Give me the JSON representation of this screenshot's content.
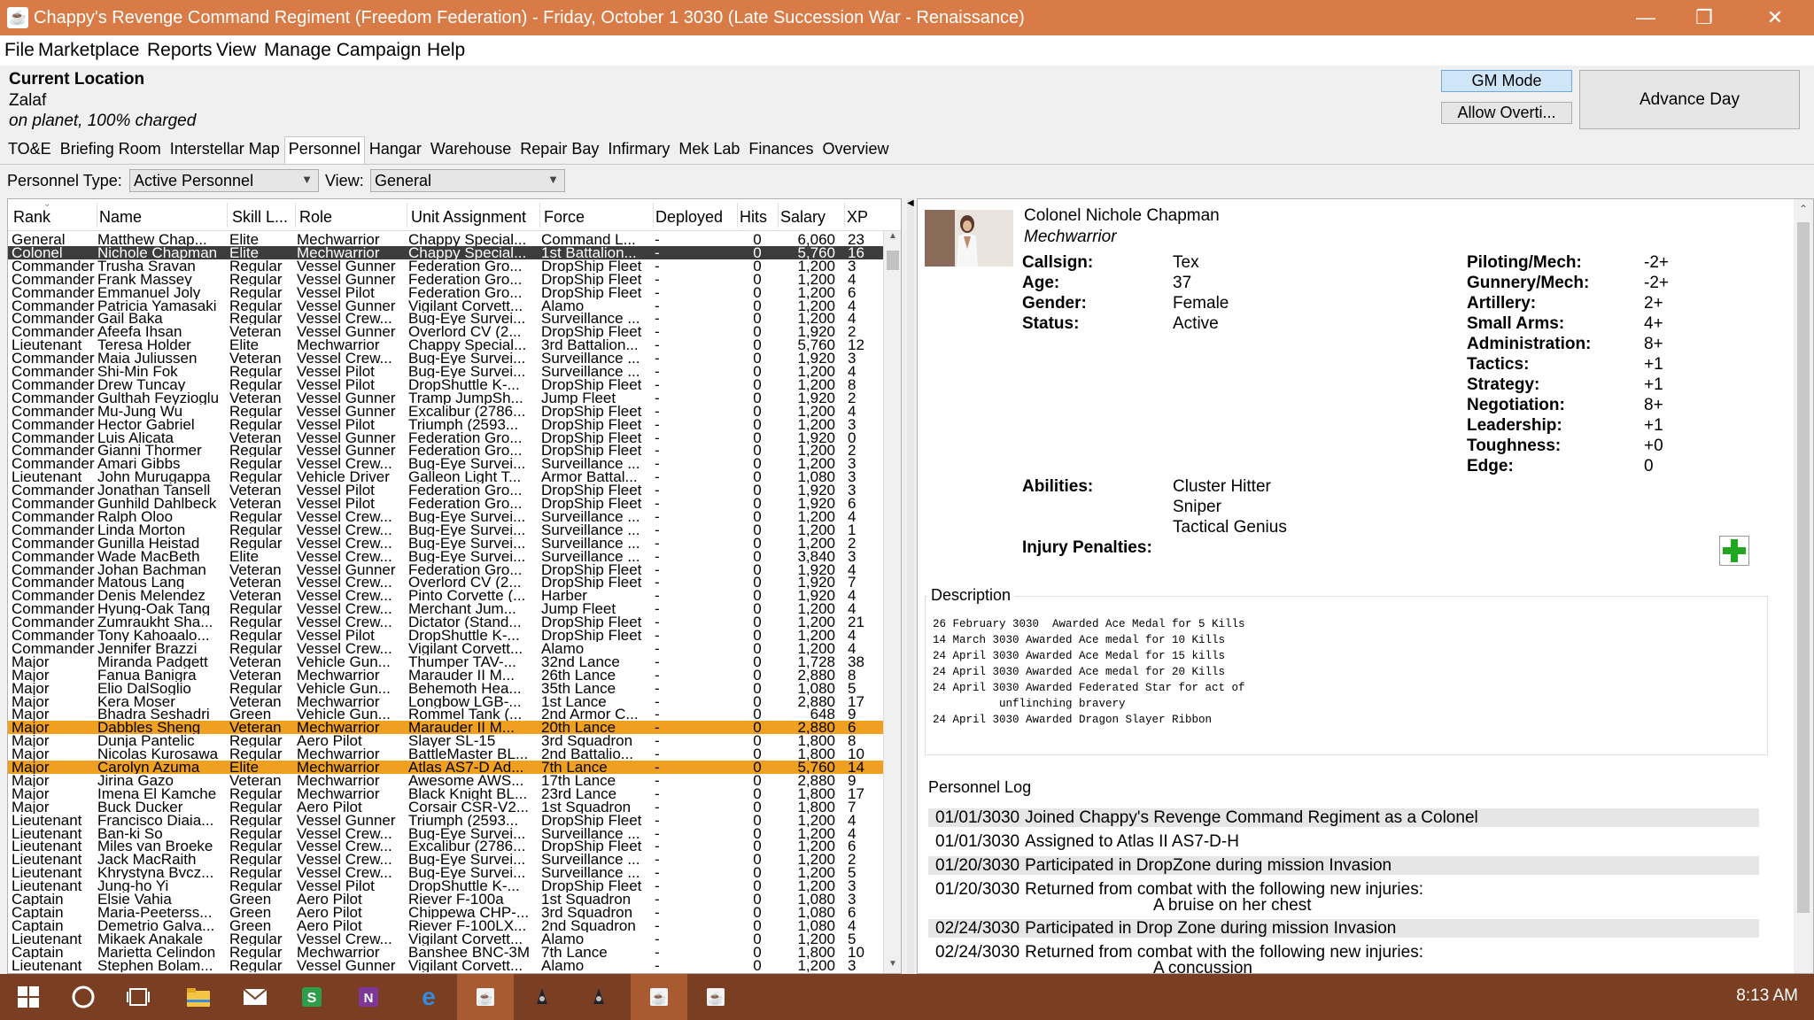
{
  "window": {
    "title": "Chappy's Revenge Command Regiment (Freedom Federation) - Friday, October 1 3030 (Late Succession War - Renaissance)",
    "controls": [
      "—",
      "❐",
      "✕"
    ]
  },
  "menu": [
    "File",
    "Marketplace",
    "Reports",
    "View",
    "Manage Campaign",
    "Help"
  ],
  "location": {
    "heading": "Current Location",
    "planet": "Zalaf",
    "status": "on planet, 100% charged"
  },
  "buttons": {
    "gm_mode": "GM Mode",
    "allow_overtime": "Allow Overti...",
    "advance_day": "Advance Day"
  },
  "tabs": [
    "TO&E",
    "Briefing Room",
    "Interstellar Map",
    "Personnel",
    "Hangar",
    "Warehouse",
    "Repair Bay",
    "Infirmary",
    "Mek Lab",
    "Finances",
    "Overview"
  ],
  "active_tab": "Personnel",
  "filters": {
    "personnel_type_label": "Personnel Type:",
    "personnel_type_value": "Active Personnel",
    "view_label": "View:",
    "view_value": "General"
  },
  "table": {
    "columns": [
      "Rank",
      "Name",
      "Skill L...",
      "Role",
      "Unit Assignment",
      "Force",
      "Deployed",
      "Hits",
      "Salary",
      "XP"
    ],
    "rows": [
      [
        "General",
        "Matthew Chap...",
        "Elite",
        "Mechwarrior",
        "Chappy Special...",
        "Command L...",
        "-",
        "0",
        "6,060",
        "23",
        ""
      ],
      [
        "Colonel",
        "Nichole Chapman",
        "Elite",
        "Mechwarrior",
        "Chappy Special...",
        "1st Battalion...",
        "-",
        "0",
        "5,760",
        "16",
        "sel"
      ],
      [
        "Commander",
        "Trusha Sravan",
        "Regular",
        "Vessel Gunner",
        "Federation Gro...",
        "DropShip Fleet",
        "-",
        "0",
        "1,200",
        "3",
        ""
      ],
      [
        "Commander",
        "Frank Massey",
        "Regular",
        "Vessel Gunner",
        "Federation Gro...",
        "DropShip Fleet",
        "-",
        "0",
        "1,200",
        "4",
        ""
      ],
      [
        "Commander",
        "Emmanuel Joly",
        "Regular",
        "Vessel Pilot",
        "Federation Gro...",
        "DropShip Fleet",
        "-",
        "0",
        "1,200",
        "6",
        ""
      ],
      [
        "Commander",
        "Patricia Yamasaki",
        "Regular",
        "Vessel Gunner",
        "Vigilant Corvett...",
        "Alamo",
        "-",
        "0",
        "1,200",
        "4",
        ""
      ],
      [
        "Commander",
        "Gail Baka",
        "Regular",
        "Vessel Crew...",
        "Bug-Eye Survei...",
        "Surveillance ...",
        "-",
        "0",
        "1,200",
        "4",
        ""
      ],
      [
        "Commander",
        "Afeefa Ihsan",
        "Veteran",
        "Vessel Gunner",
        "Overlord CV (2...",
        "DropShip Fleet",
        "-",
        "0",
        "1,920",
        "2",
        ""
      ],
      [
        "Lieutenant",
        "Teresa Holder",
        "Elite",
        "Mechwarrior",
        "Chappy Special...",
        "3rd Battalion...",
        "-",
        "0",
        "5,760",
        "12",
        ""
      ],
      [
        "Commander",
        "Maia Juliussen",
        "Veteran",
        "Vessel Crew...",
        "Bug-Eye Survei...",
        "Surveillance ...",
        "-",
        "0",
        "1,920",
        "3",
        ""
      ],
      [
        "Commander",
        "Shi-Min Fok",
        "Regular",
        "Vessel Pilot",
        "Bug-Eye Survei...",
        "Surveillance ...",
        "-",
        "0",
        "1,200",
        "4",
        ""
      ],
      [
        "Commander",
        "Drew Tuncay",
        "Regular",
        "Vessel Pilot",
        "DropShuttle K-...",
        "DropShip Fleet",
        "-",
        "0",
        "1,200",
        "8",
        ""
      ],
      [
        "Commander",
        "Gulthah Feyzioglu",
        "Veteran",
        "Vessel Gunner",
        "Tramp JumpSh...",
        "Jump Fleet",
        "-",
        "0",
        "1,920",
        "2",
        ""
      ],
      [
        "Commander",
        "Mu-Jung Wu",
        "Regular",
        "Vessel Gunner",
        "Excalibur (2786...",
        "DropShip Fleet",
        "-",
        "0",
        "1,200",
        "4",
        ""
      ],
      [
        "Commander",
        "Hector Gabriel",
        "Regular",
        "Vessel Pilot",
        "Triumph (2593...",
        "DropShip Fleet",
        "-",
        "0",
        "1,200",
        "3",
        ""
      ],
      [
        "Commander",
        "Luis Alicata",
        "Veteran",
        "Vessel Gunner",
        "Federation Gro...",
        "DropShip Fleet",
        "-",
        "0",
        "1,920",
        "0",
        ""
      ],
      [
        "Commander",
        "Gianni Thormer",
        "Regular",
        "Vessel Gunner",
        "Federation Gro...",
        "DropShip Fleet",
        "-",
        "0",
        "1,200",
        "2",
        ""
      ],
      [
        "Commander",
        "Amari Gibbs",
        "Regular",
        "Vessel Crew...",
        "Bug-Eye Survei...",
        "Surveillance ...",
        "-",
        "0",
        "1,200",
        "3",
        ""
      ],
      [
        "Lieutenant",
        "John Murugappa",
        "Regular",
        "Vehicle Driver",
        "Galleon Light T...",
        "Armor Battal...",
        "-",
        "0",
        "1,080",
        "3",
        ""
      ],
      [
        "Commander",
        "Jonathan Tansell",
        "Veteran",
        "Vessel Pilot",
        "Federation Gro...",
        "DropShip Fleet",
        "-",
        "0",
        "1,920",
        "3",
        ""
      ],
      [
        "Commander",
        "Gunhild Dahlbeck",
        "Veteran",
        "Vessel Pilot",
        "Federation Gro...",
        "DropShip Fleet",
        "-",
        "0",
        "1,920",
        "6",
        ""
      ],
      [
        "Commander",
        "Ralph Oloo",
        "Regular",
        "Vessel Crew...",
        "Bug-Eye Survei...",
        "Surveillance ...",
        "-",
        "0",
        "1,200",
        "4",
        ""
      ],
      [
        "Commander",
        "Linda Morton",
        "Regular",
        "Vessel Crew...",
        "Bug-Eye Survei...",
        "Surveillance ...",
        "-",
        "0",
        "1,200",
        "1",
        ""
      ],
      [
        "Commander",
        "Gunilla Heistad",
        "Regular",
        "Vessel Crew...",
        "Bug-Eye Survei...",
        "Surveillance ...",
        "-",
        "0",
        "1,200",
        "2",
        ""
      ],
      [
        "Commander",
        "Wade MacBeth",
        "Elite",
        "Vessel Crew...",
        "Bug-Eye Survei...",
        "Surveillance ...",
        "-",
        "0",
        "3,840",
        "3",
        ""
      ],
      [
        "Commander",
        "Johan Bachman",
        "Veteran",
        "Vessel Gunner",
        "Federation Gro...",
        "DropShip Fleet",
        "-",
        "0",
        "1,920",
        "4",
        ""
      ],
      [
        "Commander",
        "Matous Lang",
        "Veteran",
        "Vessel Crew...",
        "Overlord CV (2...",
        "DropShip Fleet",
        "-",
        "0",
        "1,920",
        "7",
        ""
      ],
      [
        "Commander",
        "Denis Melendez",
        "Veteran",
        "Vessel Crew...",
        "Pinto Corvette (...",
        "Harber",
        "-",
        "0",
        "1,920",
        "4",
        ""
      ],
      [
        "Commander",
        "Hyung-Oak Tang",
        "Regular",
        "Vessel Crew...",
        "Merchant Jum...",
        "Jump Fleet",
        "-",
        "0",
        "1,200",
        "4",
        ""
      ],
      [
        "Commander",
        "Zumraukht Sha...",
        "Regular",
        "Vessel Crew...",
        "Dictator (Stand...",
        "DropShip Fleet",
        "-",
        "0",
        "1,200",
        "21",
        ""
      ],
      [
        "Commander",
        "Tony Kahoaalo...",
        "Regular",
        "Vessel Pilot",
        "DropShuttle K-...",
        "DropShip Fleet",
        "-",
        "0",
        "1,200",
        "4",
        ""
      ],
      [
        "Commander",
        "Jennifer Brazzi",
        "Regular",
        "Vessel Crew...",
        "Vigilant Corvett...",
        "Alamo",
        "-",
        "0",
        "1,200",
        "4",
        ""
      ],
      [
        "Major",
        "Miranda Padgett",
        "Veteran",
        "Vehicle Gun...",
        "Thumper TAV-...",
        "32nd Lance",
        "-",
        "0",
        "1,728",
        "38",
        ""
      ],
      [
        "Major",
        "Fanua Banigra",
        "Veteran",
        "Mechwarrior",
        "Marauder II M...",
        "26th Lance",
        "-",
        "0",
        "2,880",
        "8",
        ""
      ],
      [
        "Major",
        "Elio DalSoglio",
        "Regular",
        "Vehicle Gun...",
        "Behemoth Hea...",
        "35th Lance",
        "-",
        "0",
        "1,080",
        "5",
        ""
      ],
      [
        "Major",
        "Kera Moser",
        "Veteran",
        "Mechwarrior",
        "Longbow LGB-...",
        "1st Lance",
        "-",
        "0",
        "2,880",
        "17",
        ""
      ],
      [
        "Major",
        "Bhadra Seshadri",
        "Green",
        "Vehicle Gun...",
        "Rommel Tank (...",
        "2nd Armor C...",
        "-",
        "0",
        "648",
        "9",
        ""
      ],
      [
        "Major",
        "Dabbles Sheng",
        "Veteran",
        "Mechwarrior",
        "Marauder II M...",
        "20th Lance",
        "-",
        "0",
        "2,880",
        "6",
        "hl"
      ],
      [
        "Major",
        "Dunja Pantelic",
        "Regular",
        "Aero Pilot",
        "Slayer SL-15",
        "3rd Squadron",
        "-",
        "0",
        "1,800",
        "8",
        ""
      ],
      [
        "Major",
        "Nicolas Kurosawa",
        "Regular",
        "Mechwarrior",
        "BattleMaster BL...",
        "2nd Battalio...",
        "-",
        "0",
        "1,800",
        "10",
        ""
      ],
      [
        "Major",
        "Carolyn Azuma",
        "Elite",
        "Mechwarrior",
        "Atlas AS7-D Ad...",
        "7th Lance",
        "-",
        "0",
        "5,760",
        "14",
        "hl"
      ],
      [
        "Major",
        "Jirina Gazo",
        "Veteran",
        "Mechwarrior",
        "Awesome AWS...",
        "17th Lance",
        "-",
        "0",
        "2,880",
        "9",
        ""
      ],
      [
        "Major",
        "Imena El Kamche",
        "Regular",
        "Mechwarrior",
        "Black Knight BL...",
        "23rd Lance",
        "-",
        "0",
        "1,800",
        "17",
        ""
      ],
      [
        "Major",
        "Buck Ducker",
        "Regular",
        "Aero Pilot",
        "Corsair CSR-V2...",
        "1st Squadron",
        "-",
        "0",
        "1,800",
        "7",
        ""
      ],
      [
        "Lieutenant",
        "Francisco Diaia...",
        "Regular",
        "Vessel Gunner",
        "Triumph (2593...",
        "DropShip Fleet",
        "-",
        "0",
        "1,200",
        "4",
        ""
      ],
      [
        "Lieutenant",
        "Ban-ki So",
        "Regular",
        "Vessel Crew...",
        "Bug-Eye Survei...",
        "Surveillance ...",
        "-",
        "0",
        "1,200",
        "4",
        ""
      ],
      [
        "Lieutenant",
        "Miles van Broeke",
        "Regular",
        "Vessel Crew...",
        "Excalibur (2786...",
        "DropShip Fleet",
        "-",
        "0",
        "1,200",
        "6",
        ""
      ],
      [
        "Lieutenant",
        "Jack MacRaith",
        "Regular",
        "Vessel Crew...",
        "Bug-Eye Survei...",
        "Surveillance ...",
        "-",
        "0",
        "1,200",
        "2",
        ""
      ],
      [
        "Lieutenant",
        "Khrystyna Bvcz...",
        "Regular",
        "Vessel Crew...",
        "Bug-Eye Survei...",
        "Surveillance ...",
        "-",
        "0",
        "1,200",
        "5",
        ""
      ],
      [
        "Lieutenant",
        "Jung-ho Yi",
        "Regular",
        "Vessel Pilot",
        "DropShuttle K-...",
        "DropShip Fleet",
        "-",
        "0",
        "1,200",
        "3",
        ""
      ],
      [
        "Captain",
        "Elsie Vahia",
        "Green",
        "Aero Pilot",
        "Riever F-100a",
        "1st Squadron",
        "-",
        "0",
        "1,080",
        "3",
        ""
      ],
      [
        "Captain",
        "Maria-Peeterss...",
        "Green",
        "Aero Pilot",
        "Chippewa CHP-...",
        "3rd Squadron",
        "-",
        "0",
        "1,080",
        "6",
        ""
      ],
      [
        "Captain",
        "Demetrio Galva...",
        "Green",
        "Aero Pilot",
        "Riever F-100LX...",
        "2nd Squadron",
        "-",
        "0",
        "1,080",
        "4",
        ""
      ],
      [
        "Lieutenant",
        "Mikaek Anakale",
        "Regular",
        "Vessel Crew...",
        "Vigilant Corvett...",
        "Alamo",
        "-",
        "0",
        "1,200",
        "5",
        ""
      ],
      [
        "Captain",
        "Marietta Celindon",
        "Regular",
        "Mechwarrior",
        "Banshee BNC-3M",
        "7th Lance",
        "-",
        "0",
        "1,800",
        "10",
        ""
      ],
      [
        "Lieutenant",
        "Stephen Bolam...",
        "Regular",
        "Vessel Gunner",
        "Vigilant Corvett...",
        "Alamo",
        "-",
        "0",
        "1,200",
        "3",
        ""
      ]
    ]
  },
  "detail": {
    "full_name": "Colonel Nichole Chapman",
    "role": "Mechwarrior",
    "fields": [
      {
        "label": "Callsign:",
        "value": "Tex"
      },
      {
        "label": "Age:",
        "value": "37"
      },
      {
        "label": "Gender:",
        "value": "Female"
      },
      {
        "label": "Status:",
        "value": "Active"
      }
    ],
    "skills": [
      {
        "label": "Piloting/Mech:",
        "value": "-2+"
      },
      {
        "label": "Gunnery/Mech:",
        "value": "-2+"
      },
      {
        "label": "Artillery:",
        "value": "2+"
      },
      {
        "label": "Small Arms:",
        "value": "4+"
      },
      {
        "label": "Administration:",
        "value": "8+"
      },
      {
        "label": "Tactics:",
        "value": "+1"
      },
      {
        "label": "Strategy:",
        "value": "+1"
      },
      {
        "label": "Negotiation:",
        "value": "8+"
      },
      {
        "label": "Leadership:",
        "value": "+1"
      },
      {
        "label": "Toughness:",
        "value": "+0"
      },
      {
        "label": "Edge:",
        "value": "0"
      }
    ],
    "abilities_label": "Abilities:",
    "abilities": [
      "Cluster Hitter",
      "Sniper",
      "Tactical Genius"
    ],
    "injury_label": "Injury Penalties:",
    "description_title": "Description",
    "description_lines": [
      "26 February 3030  Awarded Ace Medal for 5 Kills",
      "14 March 3030 Awarded Ace medal for 10 Kills",
      "24 April 3030 Awarded Ace Medal for 15 kills",
      "24 April 3030 Awarded Ace medal for 20 Kills",
      "24 April 3030 Awarded Federated Star for act of",
      "          unflinching bravery",
      "24 April 3030 Awarded Dragon Slayer Ribbon"
    ],
    "log_title": "Personnel Log",
    "log": [
      {
        "date": "01/01/3030",
        "text": "Joined Chappy's Revenge Command Regiment as a Colonel",
        "shade": true
      },
      {
        "date": "01/01/3030",
        "text": "Assigned to Atlas II AS7-D-H",
        "shade": false
      },
      {
        "date": "01/20/3030",
        "text": "Participated in DropZone during mission Invasion",
        "shade": true
      },
      {
        "date": "01/20/3030",
        "text": "Returned from combat with the following new injuries:",
        "sub": "A bruise on her chest",
        "shade": false
      },
      {
        "date": "02/24/3030",
        "text": "Participated in Drop Zone  during mission Invasion",
        "shade": true
      },
      {
        "date": "02/24/3030",
        "text": "Returned from combat with the following new injuries:",
        "sub": "A concussion",
        "shade": false
      }
    ]
  },
  "taskbar": {
    "clock": "8:13 AM",
    "icons": [
      "windows-start-icon",
      "cortana-icon",
      "task-view-icon",
      "file-explorer-icon",
      "mail-icon",
      "skype-icon",
      "onenote-icon",
      "edge-icon",
      "java-icon",
      "game-icon",
      "game-icon",
      "java-icon",
      "java-icon"
    ]
  },
  "colors": {
    "titlebar": "#d97b47",
    "taskbar": "#7a3f22",
    "highlight_row": "#f0a020",
    "selected_row": "#3c3c3c"
  }
}
